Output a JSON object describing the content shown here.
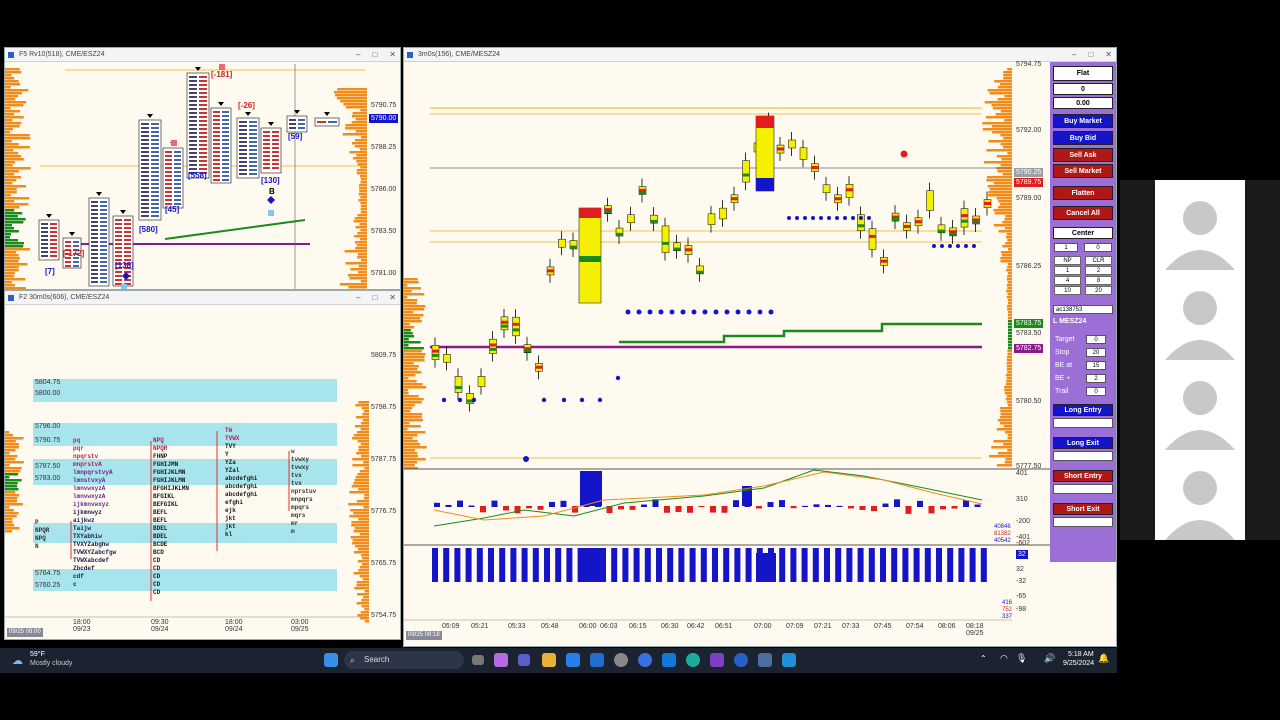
{
  "windows": {
    "top_left": {
      "title": "F5 Rv10(518), CME/ESZ24",
      "watermark": "F5",
      "price_axis": [
        "5790.75",
        "5788.25",
        "5786.00",
        "5783.50",
        "5781.00"
      ],
      "price_tag": "5790.00",
      "labels": [
        "[-181]",
        "[-26]",
        "[558]",
        "[45]",
        "[580]",
        "[130]",
        "[59]",
        "[-172]",
        "[7]",
        "[138]",
        "B"
      ]
    },
    "bottom_left": {
      "title": "F2 30m0s(606), CME/ESZ24",
      "watermark": "F2",
      "price_axis": [
        "5809.75",
        "5798.75",
        "5787.75",
        "5776.75",
        "5765.75",
        "5754.75"
      ],
      "level_labels": [
        "5804.75",
        "5800.00",
        "5796.00",
        "5790.75",
        "5787.50",
        "5783.00",
        "5764.75",
        "5760.25"
      ],
      "time_axis": [
        "18:00\n09/23",
        "09:30\n09/24",
        "18:00\n09/24",
        "03:00\n09/25"
      ],
      "cursor_date": "09/25 08:00",
      "tpo_rows": [
        "pq",
        "pqr",
        "npqrstv",
        "mnprstvA",
        "lmnpqrstvyA",
        "lmnstvxyA",
        "lmnvwxyzA",
        "lmnvwxyzA",
        "ijkmnvwxyz",
        "ijkmnwyz",
        "aijkwz",
        "Taijw",
        "TXYabhiw",
        "TVXYZabghw",
        "TVWXYZabcfgw",
        "TVWXabcdef",
        "Zbcdef",
        "cdf",
        "c"
      ],
      "tpo_col2": [
        "NPQ",
        "NPQR",
        "FHNP",
        "FGHIJMN",
        "FGHIJKLMN",
        "FGHIJKLMN",
        "BFGHIJKLMN",
        "BFGIKL",
        "BEFGIKL",
        "BEFL",
        "BEFL",
        "BDEL",
        "BDEL",
        "BCDE",
        "BCD",
        "CD",
        "CD",
        "CD",
        "CD",
        "CD"
      ],
      "tpo_col3": [
        "TW",
        "TVWX",
        "TVY",
        "Y",
        "YZa",
        "YZal",
        "abcdefghi",
        "abcdefghi",
        "abcdefghi",
        "efghi",
        "ejk",
        "jkt",
        "jkt",
        "kl"
      ],
      "tpo_col4": [
        "w",
        "tvwxy",
        "tvwxy",
        "tvx",
        "tvx",
        "nprstuv",
        "mnpqrs",
        "mpqrs",
        "mqrs",
        "mr",
        "m"
      ],
      "tpo_col0": [
        "P",
        "NPQR",
        "NPQ",
        "N"
      ]
    },
    "main": {
      "title": "3m0s(156), CME/MESZ24",
      "price_axis": [
        "5794.75",
        "5792.00",
        "5789.00",
        "5786.25",
        "5783.50",
        "5780.50",
        "5777.50"
      ],
      "price_tags": [
        {
          "text": "5790.25",
          "color": "#9aa0a6"
        },
        {
          "text": "5789.75",
          "color": "#e11d1d"
        },
        {
          "text": "5783.75",
          "color": "#1a8a1a"
        },
        {
          "text": "5782.75",
          "color": "#8b1a8b"
        }
      ],
      "time_axis": [
        "05:09",
        "05:21",
        "05:33",
        "05:48",
        "06:00",
        "06:03",
        "06:15",
        "06:30",
        "06:42",
        "06:51",
        "07:00",
        "07:09",
        "07:21",
        "07:33",
        "07:45",
        "07:54",
        "08:06",
        "08:18\n09/25"
      ],
      "cursor_date": "09/25 08:18",
      "indicator1_axis": [
        "401",
        "310",
        "-200",
        "-401",
        "-602"
      ],
      "indicator1_values": [
        "40846",
        "81382",
        "40542"
      ],
      "indicator2_axis": [
        "32",
        "-32",
        "-65",
        "-98"
      ],
      "indicator2_values": [
        "416",
        "752",
        "337"
      ],
      "indicator2_tag": "32"
    }
  },
  "order_panel": {
    "position": "Flat",
    "qty": "0",
    "pnl": "0.00",
    "buy_market": "Buy Market",
    "buy_bid": "Buy Bid",
    "sell_ask": "Sell Ask",
    "sell_market": "Sell Market",
    "flatten": "Flatten",
    "cancel_all": "Cancel All",
    "center": "Center",
    "qty_input": "1",
    "qty_right": "0",
    "grid": [
      [
        "NP",
        "CLR"
      ],
      [
        "1",
        "2"
      ],
      [
        "4",
        "8"
      ],
      [
        "10",
        "20"
      ]
    ],
    "account": "ac138753",
    "symbol": "L MESZ24",
    "fields": [
      {
        "label": "Target",
        "value": "0"
      },
      {
        "label": "Stop",
        "value": "20"
      },
      {
        "label": "BE at",
        "value": "15"
      },
      {
        "label": "BE +",
        "value": "2"
      },
      {
        "label": "Trail",
        "value": "0"
      }
    ],
    "long_entry": "Long Entry",
    "long_exit": "Long Exit",
    "short_entry": "Short Entry",
    "short_exit": "Short Exit"
  },
  "taskbar": {
    "weather_temp": "59°F",
    "weather_desc": "Mostly cloudy",
    "search_placeholder": "Search",
    "time": "5:18 AM",
    "date": "9/25/2024"
  },
  "colors": {
    "buy": "#1414c8",
    "sell": "#b01818",
    "panel": "#9b6fd6",
    "candle_up": "#f5f000",
    "candle_dn": "#e11d1d",
    "vwap": "#8b1a8b",
    "level_green": "#1a8a1a"
  }
}
